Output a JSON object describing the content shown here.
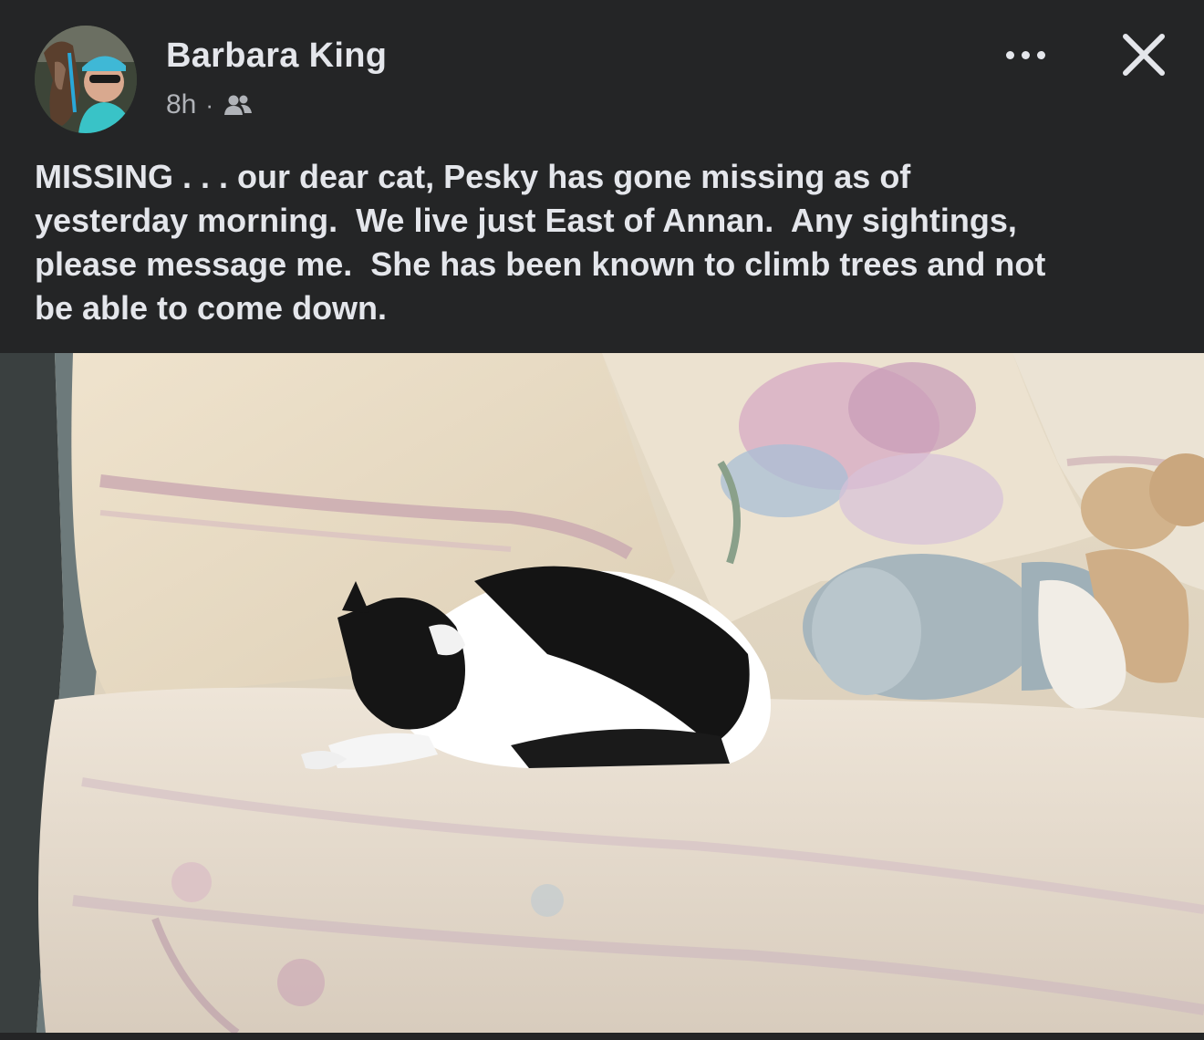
{
  "post": {
    "author": {
      "name": "Barbara King",
      "avatar": "profile-photo-woman-with-horse"
    },
    "timestamp": "8h",
    "separator": "·",
    "audience_icon": "friends-icon",
    "text": "MISSING . . . our dear cat, Pesky has gone missing as of\nyesterday morning.  We live just East of Annan.  Any sightings,\nplease message me.  She has been known to climb trees and not\nbe able to come down.",
    "photo": {
      "subject": "black-and-white-cat-sleeping-on-sofa"
    }
  },
  "icons": {
    "more": "more-horizontal-icon",
    "close": "close-icon"
  },
  "colors": {
    "background": "#242526",
    "text_primary": "#e4e6eb",
    "text_secondary": "#b0b3b8"
  }
}
